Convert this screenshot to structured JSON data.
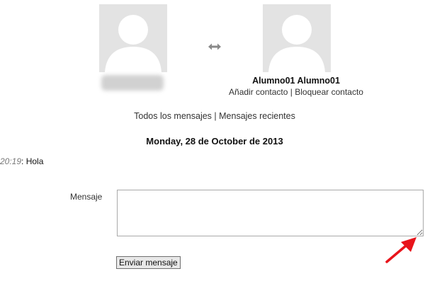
{
  "peer": {
    "name": "Alumno01 Alumno01",
    "add_contact": "Añadir contacto",
    "separator": "|",
    "block_contact": "Bloquear contacto"
  },
  "nav": {
    "all_messages": "Todos los mensajes",
    "separator": "|",
    "recent_messages": "Mensajes recientes"
  },
  "conversation": {
    "date": "Monday, 28 de October de 2013",
    "messages": [
      {
        "time": "20:19",
        "text": "Hola"
      }
    ]
  },
  "compose": {
    "label": "Mensaje",
    "value": "",
    "send_label": "Enviar mensaje"
  },
  "icons": {
    "swap": "swap-arrows-icon",
    "annotation": "red-arrow-icon"
  },
  "colors": {
    "avatar_bg": "#e3e3e3",
    "annotation_arrow": "#e8141b"
  }
}
